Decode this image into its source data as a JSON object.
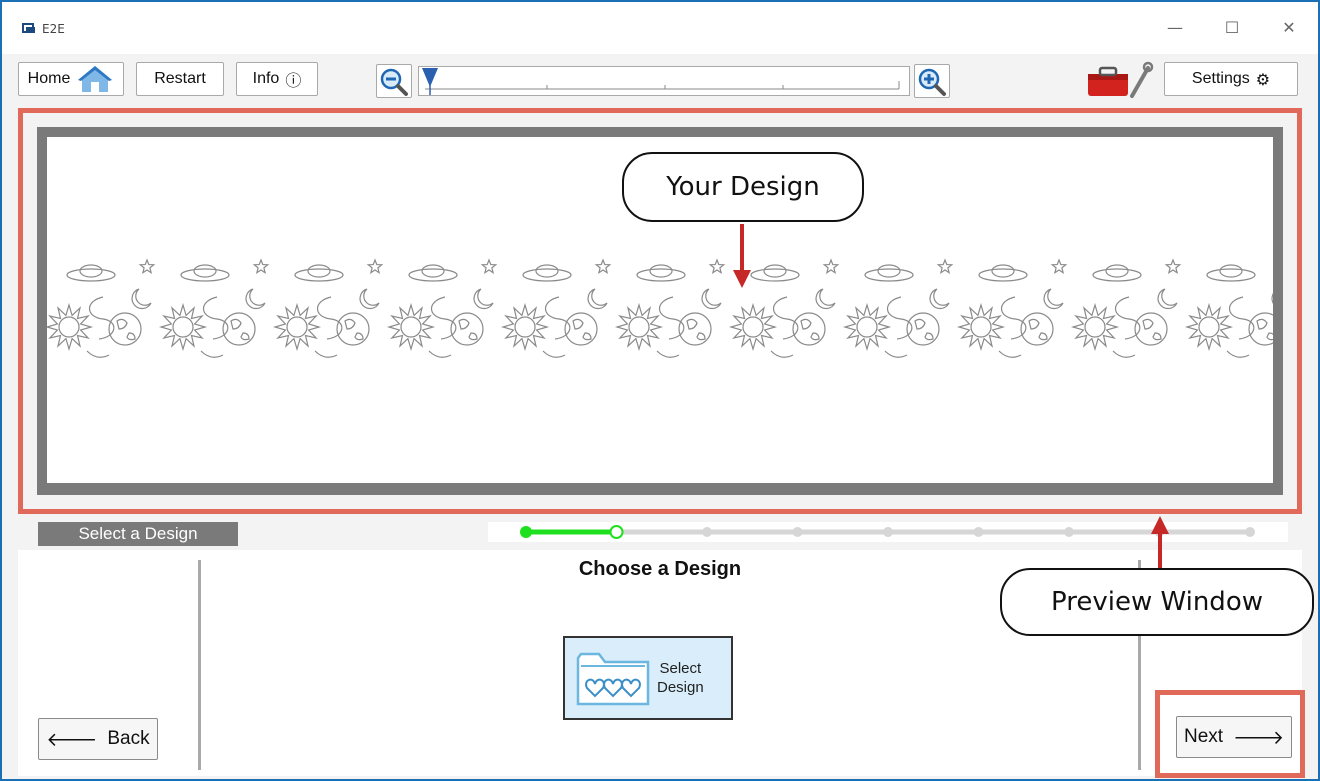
{
  "window": {
    "title": "E2E",
    "minimize_glyph": "—",
    "maximize_glyph": "☐",
    "close_glyph": "✕"
  },
  "toolbar": {
    "home_label": "Home",
    "restart_label": "Restart",
    "info_label": "Info",
    "info_icon": "ⓘ",
    "settings_label": "Settings",
    "settings_icon": "⚙"
  },
  "annotations": {
    "your_design": "Your Design",
    "preview_window": "Preview Window",
    "accent_color": "#e0695a",
    "arrow_color": "#c62828"
  },
  "progress": {
    "step_label": "Select a Design",
    "total_steps": 9,
    "current_step": 2,
    "active_color": "#1ee01e"
  },
  "main": {
    "section_title": "Choose a Design",
    "select_design_label_line1": "Select",
    "select_design_label_line2": "Design"
  },
  "nav": {
    "back_label": "Back",
    "back_arrow": "🡐",
    "next_label": "Next",
    "next_arrow": "🡒"
  }
}
